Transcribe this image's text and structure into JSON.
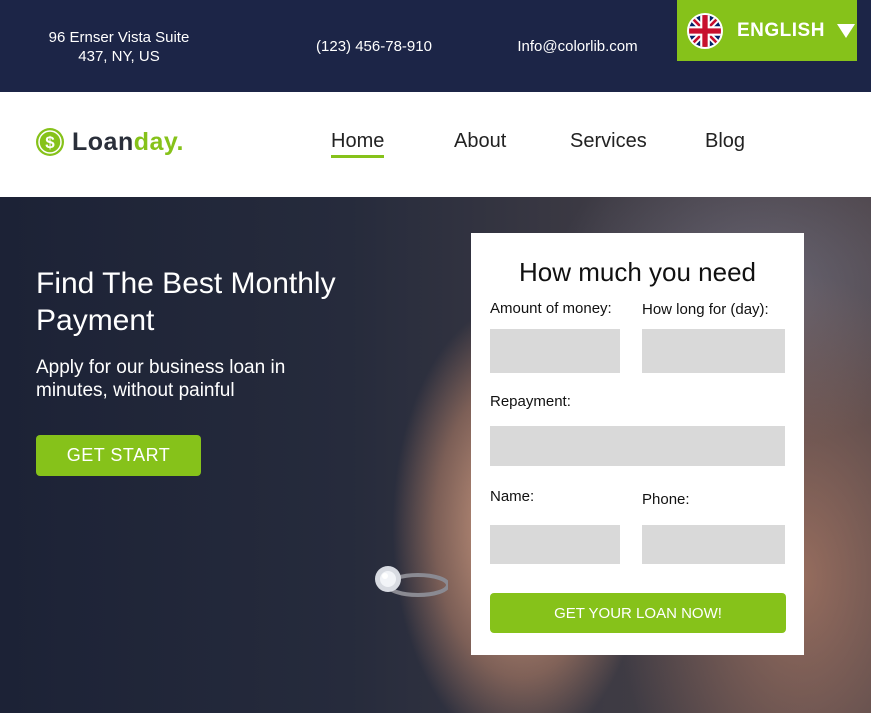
{
  "topbar": {
    "address_line1": "96 Ernser Vista Suite",
    "address_line2": "437, NY, US",
    "phone": "(123) 456-78-910",
    "email": "Info@colorlib.com",
    "language": "ENGLISH",
    "language_flag": "uk-flag-icon",
    "background_color": "#1c2547"
  },
  "navbar": {
    "logo_icon": "dollar-coin-icon",
    "logo_text_1": "Loan",
    "logo_text_2": "day.",
    "items": [
      {
        "label": "Home",
        "active": true
      },
      {
        "label": "About",
        "active": false
      },
      {
        "label": "Services",
        "active": false
      },
      {
        "label": "Blog",
        "active": false
      }
    ]
  },
  "hero": {
    "title": "Find The Best Monthly Payment",
    "subtitle": "Apply for our business loan in minutes, without painful",
    "cta_label": "GET START"
  },
  "form": {
    "title": "How much you need",
    "amount_label": "Amount of money:",
    "duration_label": "How long for (day):",
    "repayment_label": "Repayment:",
    "name_label": "Name:",
    "phone_label": "Phone:",
    "submit_label": "GET YOUR LOAN NOW!"
  },
  "colors": {
    "accent": "#86c21a",
    "dark": "#1c2547",
    "field": "#d9d9d9"
  }
}
